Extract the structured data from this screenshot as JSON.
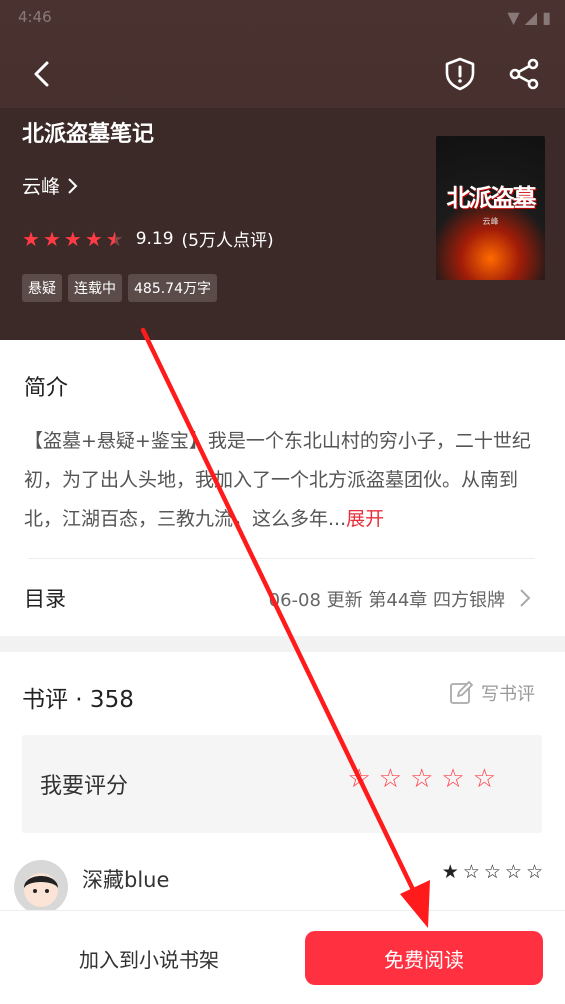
{
  "status_bar": {
    "time": "4:46",
    "indicators": "▼ ◢ ▮"
  },
  "book": {
    "title": "北派盗墓笔记",
    "author": "云峰",
    "rating": "9.19",
    "rating_count": "(5万人点评)",
    "stars_filled": 4.5,
    "tags": [
      "悬疑",
      "连载中",
      "485.74万字"
    ],
    "cover_title": "北派盗墓",
    "cover_author": "云峰"
  },
  "intro": {
    "heading": "简介",
    "text": "【盗墓+悬疑+鉴宝】我是一个东北山村的穷小子，二十世纪初，为了出人头地，我加入了一个北方派盗墓团伙。从南到北，江湖百态，三教九流，这么多年...",
    "expand_label": "展开"
  },
  "toc": {
    "label": "目录",
    "update_text": "06-08  更新  第44章 四方银牌"
  },
  "reviews": {
    "title": "书评 · 358",
    "write_label": "写书评",
    "rate_prompt": "我要评分",
    "reviewer": {
      "name": "深藏blue",
      "stars": 1
    }
  },
  "bottom": {
    "shelf_label": "加入到小说书架",
    "read_label": "免费阅读"
  },
  "colors": {
    "header_bg": "#3f2b29",
    "accent": "#ff3040",
    "star": "#ff3b45"
  },
  "icons": {
    "back": "back-arrow-icon",
    "report": "shield-alert-icon",
    "share": "share-icon",
    "chevron": "chevron-right-icon",
    "write": "edit-icon"
  }
}
